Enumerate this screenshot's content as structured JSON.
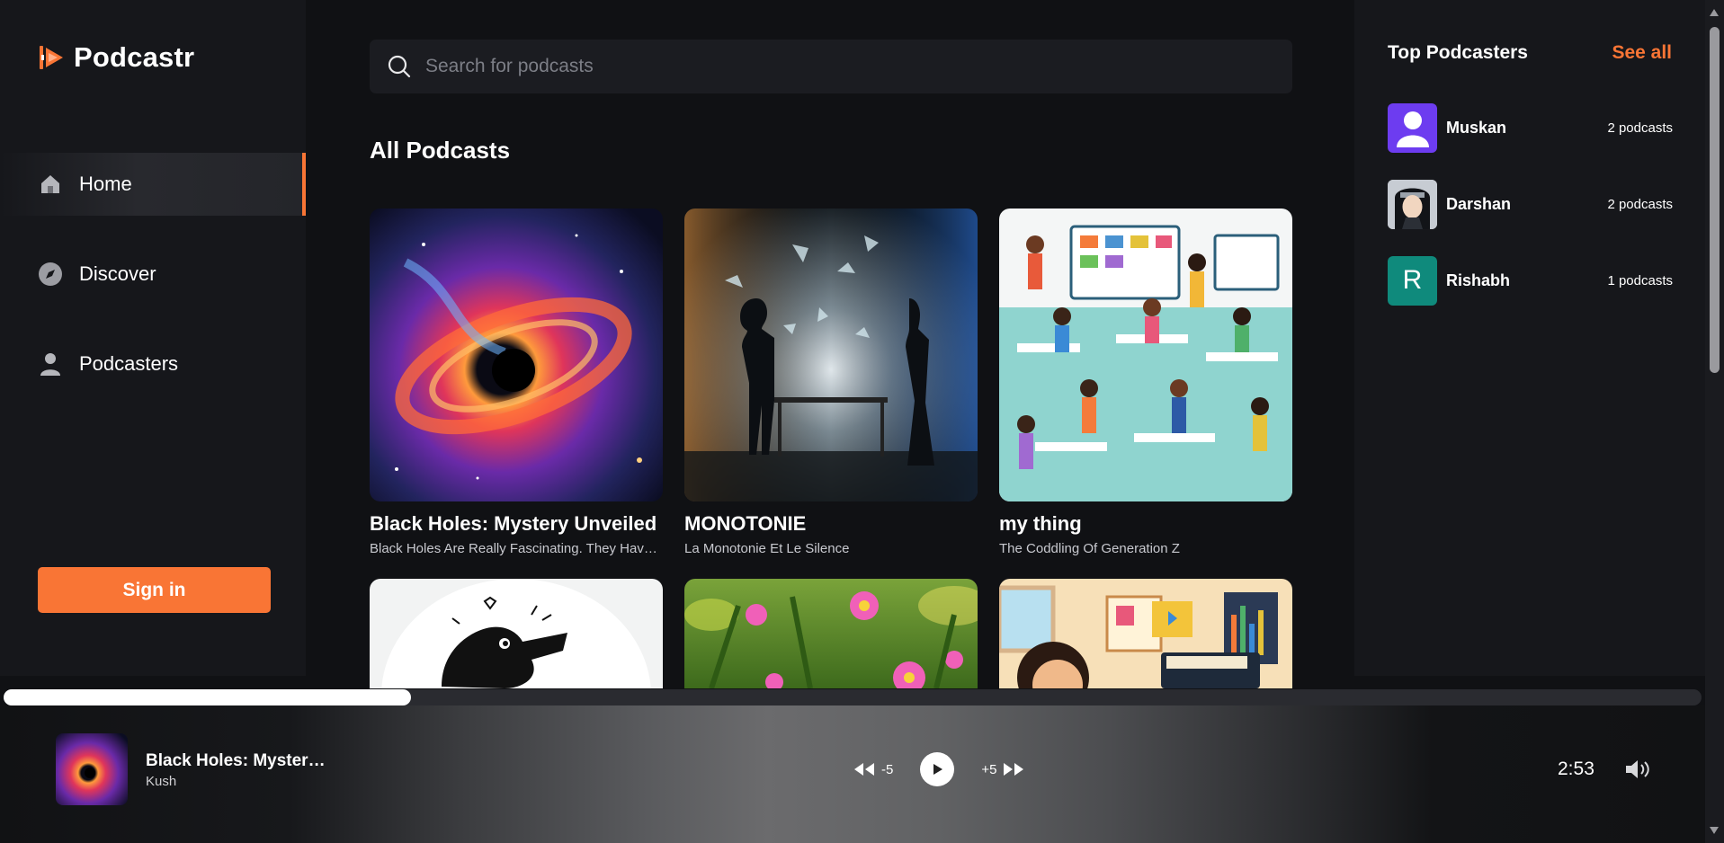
{
  "app": {
    "name": "Podcastr"
  },
  "sidebar": {
    "items": [
      {
        "label": "Home",
        "icon": "home-icon",
        "active": true
      },
      {
        "label": "Discover",
        "icon": "compass-icon",
        "active": false
      },
      {
        "label": "Podcasters",
        "icon": "user-icon",
        "active": false
      }
    ],
    "signin_label": "Sign in"
  },
  "search": {
    "placeholder": "Search for podcasts"
  },
  "main": {
    "section_title": "All Podcasts",
    "podcasts": [
      {
        "title": "Black Holes: Mystery Unveiled",
        "description": "Black Holes Are Really Fascinating. They Have Some Mysteries"
      },
      {
        "title": "MONOTONIE",
        "description": "La Monotonie Et Le Silence"
      },
      {
        "title": "my thing",
        "description": "The Coddling Of Generation Z"
      }
    ]
  },
  "right": {
    "title": "Top Podcasters",
    "see_all": "See all",
    "podcasters": [
      {
        "name": "Muskan",
        "count": "2 podcasts",
        "avatar": "default-avatar"
      },
      {
        "name": "Darshan",
        "count": "2 podcasts",
        "avatar": "photo-avatar"
      },
      {
        "name": "Rishabh",
        "count": "1 podcasts",
        "avatar": "letter-avatar",
        "initial": "R"
      }
    ]
  },
  "player": {
    "title": "Black Holes: Mystery Unveiled",
    "artist": "Kush",
    "rewind_label": "-5",
    "forward_label": "+5",
    "time": "2:53",
    "progress": 0.24
  },
  "colors": {
    "accent": "#f97535",
    "background": "#101114",
    "panel": "#16171b"
  }
}
